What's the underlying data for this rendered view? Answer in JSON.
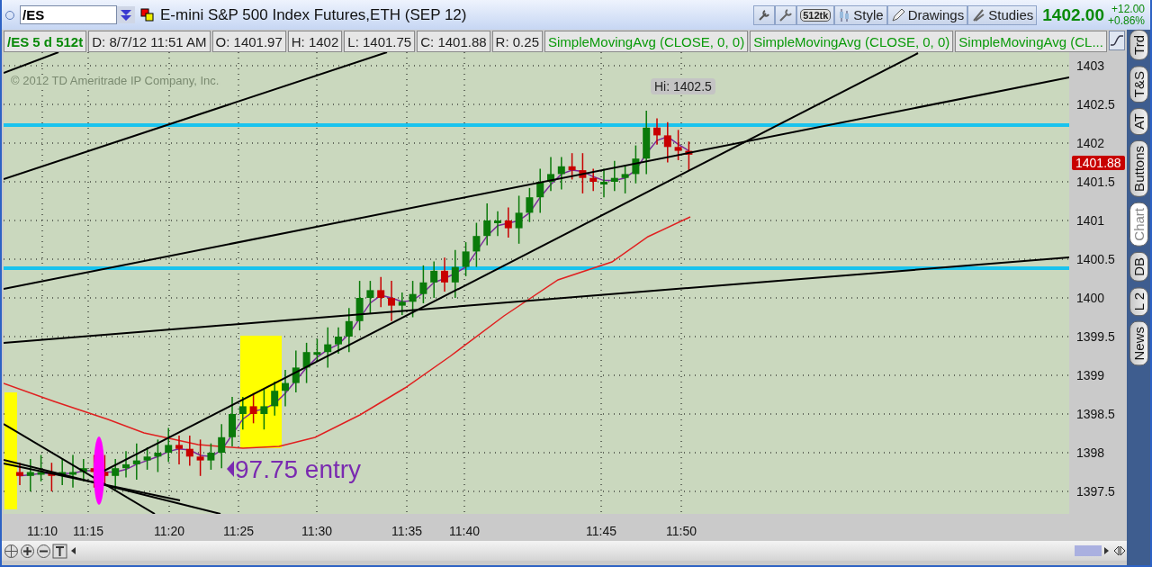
{
  "symbol_field": {
    "value": "/ES"
  },
  "instrument_title": "E-mini S&P 500 Index Futures,ETH (SEP 12)",
  "toolbar": [
    {
      "kind": "icon"
    },
    {
      "kind": "icon2"
    },
    {
      "kind": "badge",
      "label": "512tk"
    },
    {
      "kind": "style",
      "label": "Style"
    },
    {
      "kind": "drawings",
      "label": "Drawings"
    },
    {
      "kind": "studies",
      "label": "Studies"
    }
  ],
  "quote": {
    "last": "1402.00",
    "change": "+12.00",
    "percent": "+0.86%"
  },
  "info_bar": [
    {
      "kind": "symbol",
      "text": "/ES 5 d 512t"
    },
    {
      "kind": "plain",
      "text": "D: 8/7/12 11:51 AM"
    },
    {
      "kind": "plain",
      "text": "O: 1401.97"
    },
    {
      "kind": "plain",
      "text": "H: 1402"
    },
    {
      "kind": "plain",
      "text": "L: 1401.75"
    },
    {
      "kind": "plain",
      "text": "C: 1401.88"
    },
    {
      "kind": "plain",
      "text": "R: 0.25"
    },
    {
      "kind": "study",
      "text": "SimpleMovingAvg (CLOSE, 0, 0)"
    },
    {
      "kind": "study",
      "text": "SimpleMovingAvg (CLOSE, 0, 0)"
    },
    {
      "kind": "study",
      "text": "SimpleMovingAvg (CL..."
    }
  ],
  "chart": {
    "copyright": "© 2012 TD Ameritrade IP Company, Inc.",
    "high_label": "Hi: 1402.5",
    "annotation": "97.75 entry",
    "current_price": "1401.88",
    "price_ticks": [
      "1403",
      "1402.5",
      "1402",
      "1401.5",
      "1401",
      "1400.5",
      "1400",
      "1399.5",
      "1399",
      "1398.5",
      "1398",
      "1397.5"
    ],
    "time_ticks": [
      "11:10",
      "11:15",
      "11:20",
      "11:25",
      "11:30",
      "11:35",
      "11:40",
      "11:45",
      "11:50"
    ]
  },
  "side_tabs": [
    {
      "label": "Trd",
      "selected": false
    },
    {
      "label": "T&S",
      "selected": false
    },
    {
      "label": "AT",
      "selected": false
    },
    {
      "label": "Buttons",
      "selected": false
    },
    {
      "label": "Chart",
      "selected": true
    },
    {
      "label": "DB",
      "selected": false
    },
    {
      "label": "L 2",
      "selected": false
    },
    {
      "label": "News",
      "selected": false
    }
  ]
}
